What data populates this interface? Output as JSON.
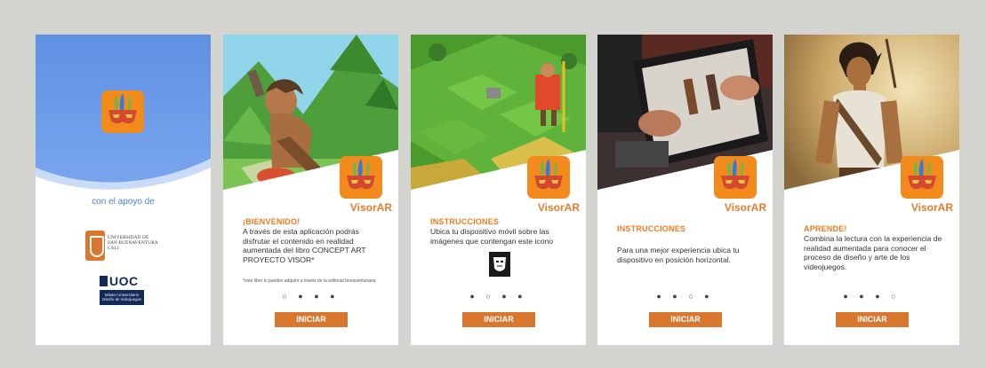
{
  "colors": {
    "background": "#d3d4cf",
    "accent": "#e27d2e",
    "button": "#d9772f",
    "splash_blue": "#5f91e3",
    "title_orange": "#f07a1e"
  },
  "splash": {
    "support_text": "con el apoyo de",
    "usb_lines": [
      "UNIVERSIDAD DE",
      "SAN BUENAVENTURA",
      "CALI"
    ],
    "uoc_name": "UOC",
    "uoc_sub": "Máster Universitario Diseño de Videojuegos"
  },
  "slides": [
    {
      "app_name": "VisorAR",
      "title": "¡BIENVENIDO!",
      "body": "A través de esta aplicación podrás disfrutar el contenido en realidad aumentada del libro CONCEPT ART PROYECTO VISOR*",
      "fineprint": "*este libro lo puedes adquirir a través de la editorial bonaventuriana",
      "dots": "○ ● ● ●",
      "button": "INICIAR"
    },
    {
      "app_name": "VisorAR",
      "title": "INSTRUCCIONES",
      "body": "Ubica tu dispositivo móvil sobre las imágenes que contengan este icono",
      "dots": "● ○ ● ●",
      "button": "INICIAR"
    },
    {
      "app_name": "VisorAR",
      "title": "INSTRUCCIONES",
      "body": "Para una mejor experiencia ubica tu dispositivo en posición horizontal.",
      "dots": "● ● ○ ●",
      "button": "INICIAR"
    },
    {
      "app_name": "VisorAR",
      "title": "APRENDE!",
      "body": "Combina la lectura con la experiencia de realidad aumentada para conocer el proceso de diseño y arte de los videojuegos.",
      "dots": "● ● ● ○",
      "button": "INICIAR"
    }
  ],
  "icons": {
    "app": "mask-feathers-icon",
    "marker": "face-scan-icon"
  }
}
